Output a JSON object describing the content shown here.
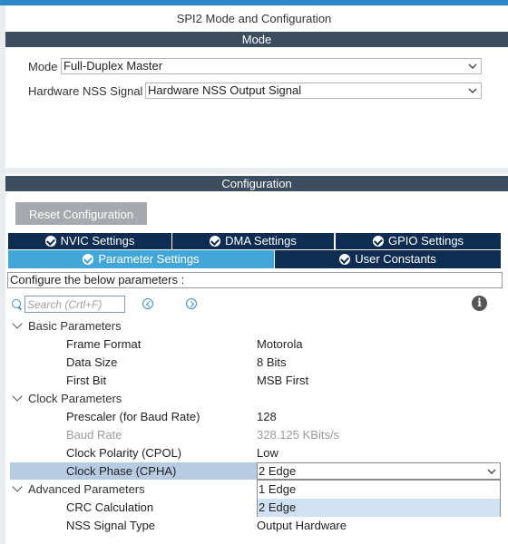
{
  "window_title": "SPI2 Mode and Configuration",
  "mode_section": {
    "header": "Mode",
    "mode_label": "Mode",
    "mode_value": "Full-Duplex Master",
    "nss_label": "Hardware NSS Signal",
    "nss_value": "Hardware NSS Output Signal"
  },
  "config_section": {
    "header": "Configuration",
    "reset_button": "Reset Configuration",
    "tabs_row1": [
      "NVIC Settings",
      "DMA Settings",
      "GPIO Settings"
    ],
    "tabs_row2": [
      "Parameter Settings",
      "User Constants"
    ],
    "active_tab": "Parameter Settings",
    "note": "Configure the below parameters :",
    "search_placeholder": "Search (Crtl+F)"
  },
  "groups": [
    {
      "name": "Basic Parameters",
      "params": [
        {
          "name": "Frame Format",
          "value": "Motorola"
        },
        {
          "name": "Data Size",
          "value": "8 Bits"
        },
        {
          "name": "First Bit",
          "value": "MSB First"
        }
      ]
    },
    {
      "name": "Clock Parameters",
      "params": [
        {
          "name": "Prescaler (for Baud Rate)",
          "value": "128"
        },
        {
          "name": "Baud Rate",
          "value": "328.125 KBits/s"
        },
        {
          "name": "Clock Polarity (CPOL)",
          "value": "Low"
        },
        {
          "name": "Clock Phase (CPHA)",
          "value": "2 Edge"
        }
      ]
    },
    {
      "name": "Advanced Parameters",
      "params": [
        {
          "name": "CRC Calculation",
          "value": ""
        },
        {
          "name": "NSS Signal Type",
          "value": "Output Hardware"
        }
      ]
    }
  ],
  "dropdown_options": [
    "1 Edge",
    "2 Edge"
  ],
  "dropdown_selected": "2 Edge",
  "colors": {
    "accent_bar": "#2f86c9",
    "section_header": "#3b4d5f",
    "tab_bg": "#0f2d52",
    "tab_active": "#43a6d9",
    "selection": "#b7cbe3"
  }
}
